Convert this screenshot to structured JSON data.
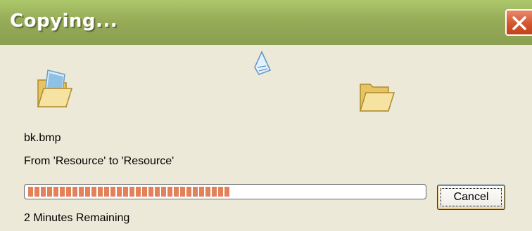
{
  "dialog": {
    "title": "Copying...",
    "filename": "bk.bmp",
    "from_to": "From 'Resource' to 'Resource'",
    "progress_fraction": 0.51,
    "cancel_label": "Cancel",
    "time_remaining": "2 Minutes Remaining"
  },
  "icons": {
    "source": "folder-open-with-paper-icon",
    "transfer": "flying-paper-icon",
    "destination": "folder-open-icon",
    "close": "close-icon"
  },
  "colors": {
    "titlebar": "#96ac58",
    "window": "#ece9d8",
    "close_button": "#d4562e",
    "progress": "#e3825a"
  }
}
